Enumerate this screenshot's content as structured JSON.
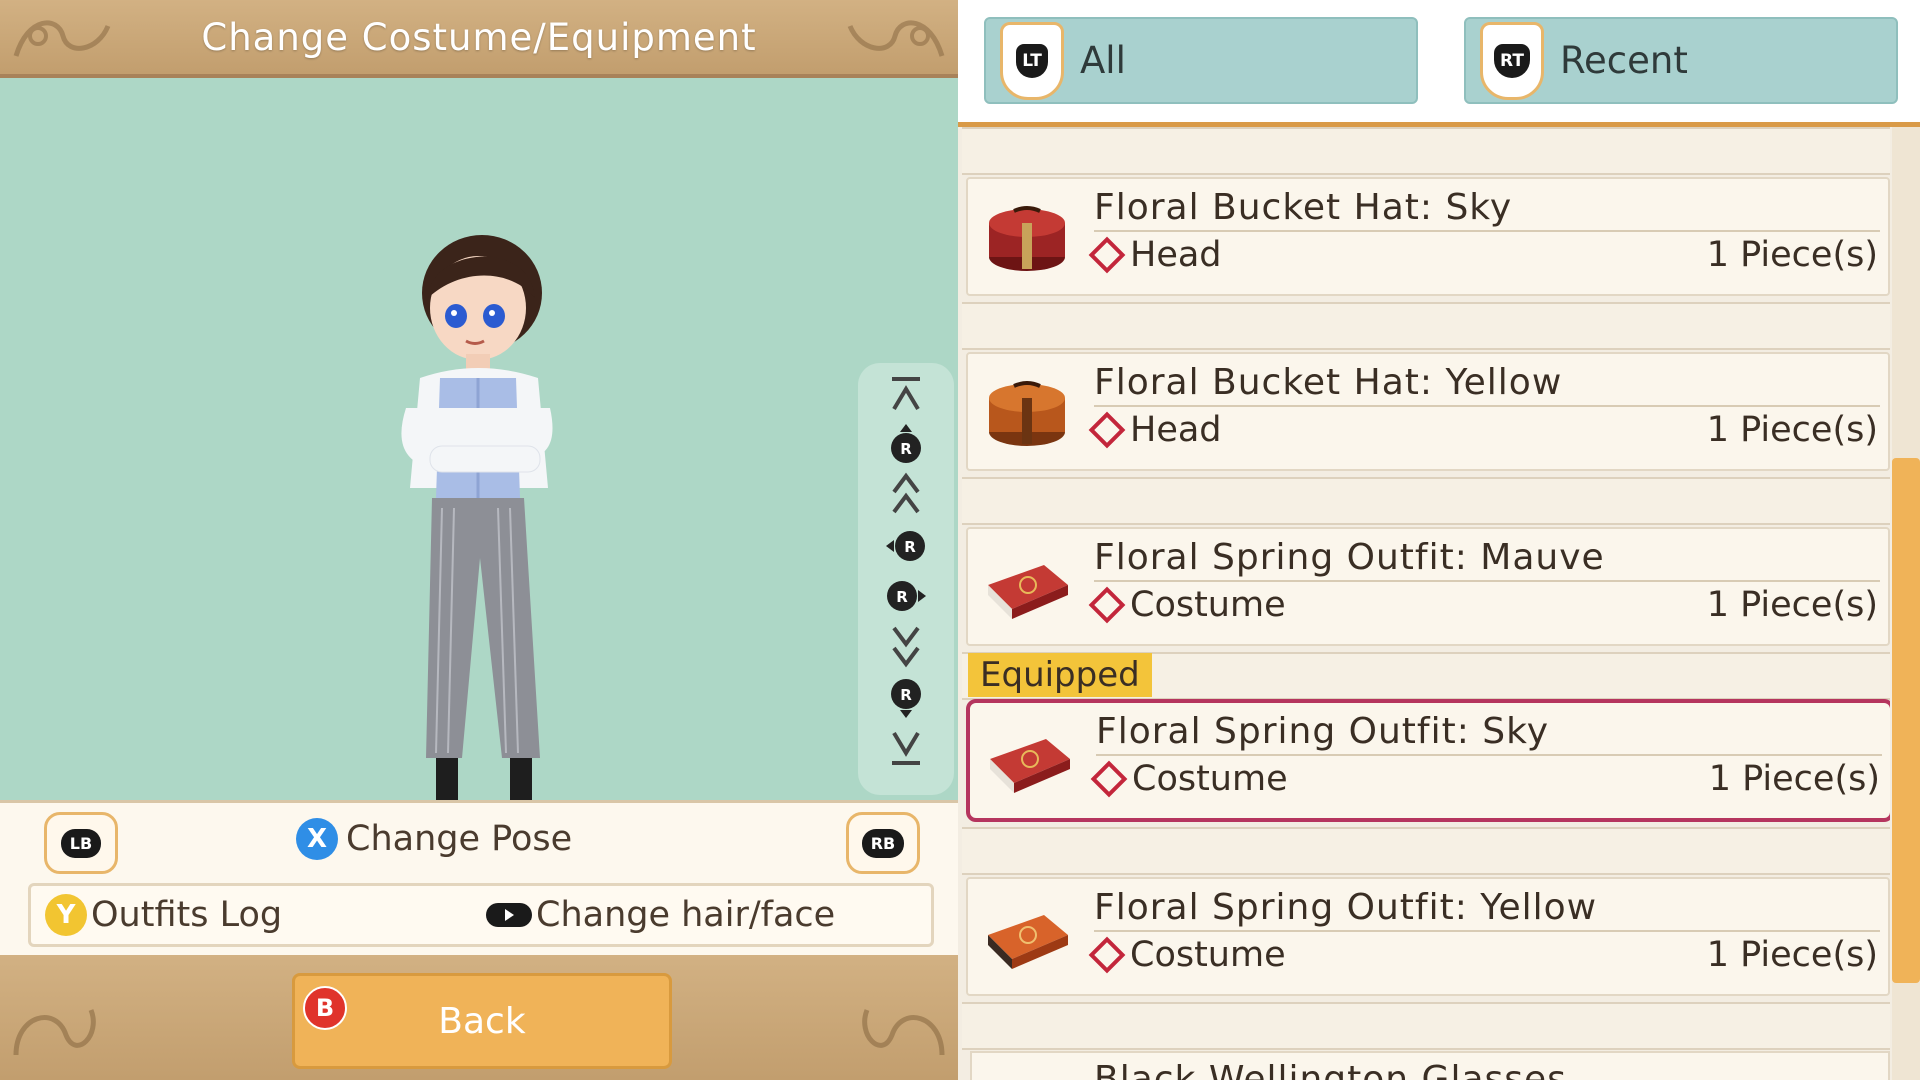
{
  "left_panel": {
    "title": "Change Costume/Equipment",
    "pose_bar": {
      "lb": "LB",
      "rb": "RB",
      "x_button": "X",
      "change_pose": "Change Pose"
    },
    "sub_bar": {
      "y_button": "Y",
      "outfits_log": "Outfits Log",
      "change_hair_face": "Change hair/face"
    },
    "back": {
      "b_button": "B",
      "label": "Back"
    },
    "camera_controls": [
      "zoom-to-top-icon",
      "r-stick-up-icon",
      "move-up-icon",
      "r-stick-left-icon",
      "r-stick-right-icon",
      "move-down-icon",
      "r-stick-down-icon",
      "zoom-to-bottom-icon"
    ]
  },
  "right_panel": {
    "tabs": [
      {
        "trigger": "LT",
        "label": "All"
      },
      {
        "trigger": "RT",
        "label": "Recent"
      }
    ],
    "equipped_tag": "Equipped",
    "items": [
      {
        "name": "Floral Bucket Hat: Sky",
        "slot": "Head",
        "qty": "1 Piece(s)",
        "icon": "hatbox-red-icon",
        "color": "#9c2424"
      },
      {
        "name": "Floral Bucket Hat: Yellow",
        "slot": "Head",
        "qty": "1 Piece(s)",
        "icon": "hatbox-orange-icon",
        "color": "#b8571c"
      },
      {
        "name": "Floral Spring Outfit: Mauve",
        "slot": "Costume",
        "qty": "1 Piece(s)",
        "icon": "suitcase-red-icon",
        "color": "#a81f24"
      },
      {
        "name": "Floral Spring Outfit: Sky",
        "slot": "Costume",
        "qty": "1 Piece(s)",
        "icon": "suitcase-red-icon",
        "color": "#a81f24"
      },
      {
        "name": "Floral Spring Outfit: Yellow",
        "slot": "Costume",
        "qty": "1 Piece(s)",
        "icon": "suitcase-orange-icon",
        "color": "#c8531f"
      }
    ],
    "partial_item": "Black Wellington Glasses"
  },
  "colors": {
    "accent": "#f0b358",
    "equipped_border": "#b5355e",
    "viewport": "#add7c6",
    "tab": "#a9d1cf"
  }
}
